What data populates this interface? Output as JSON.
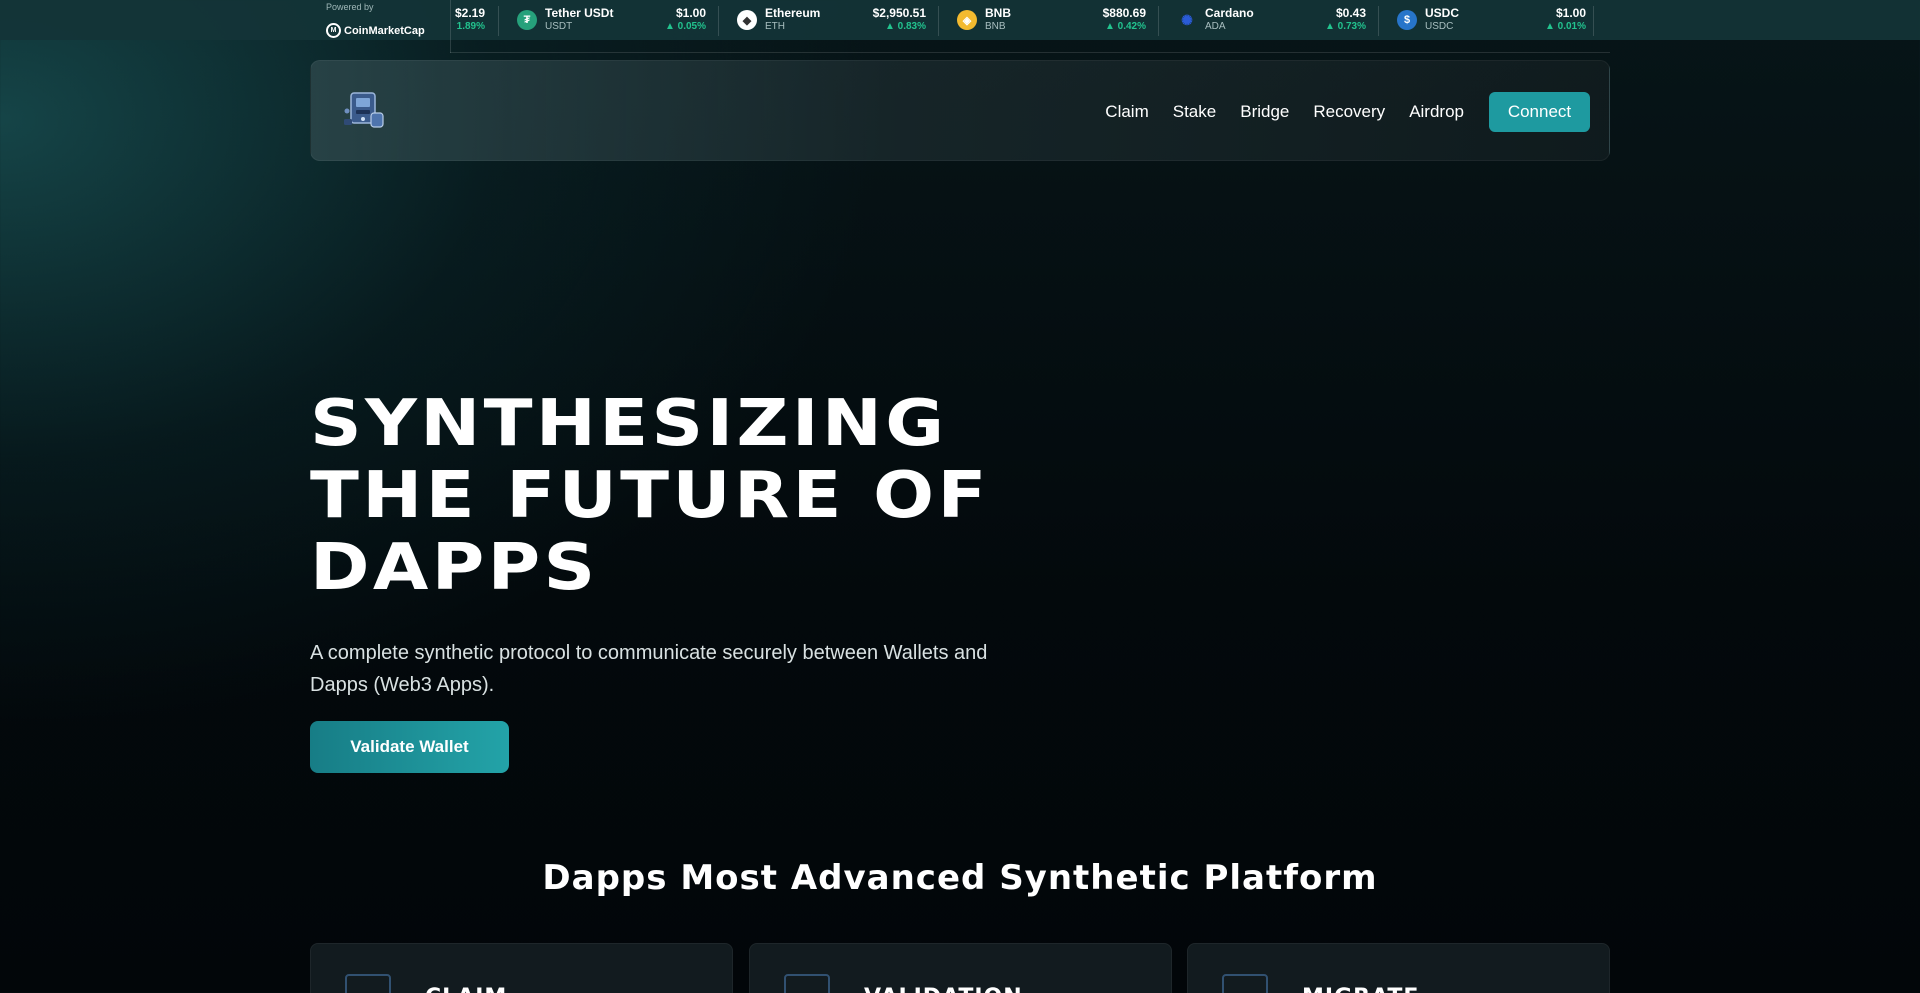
{
  "ticker": {
    "powered_by": "Powered by",
    "brand": "CoinMarketCap",
    "partial": {
      "price": "$2.19",
      "change": "1.89%"
    },
    "coins": [
      {
        "name": "Tether USDt",
        "symbol": "USDT",
        "price": "$1.00",
        "change": "▲ 0.05%",
        "icon": "tether-icon",
        "color": "#26a17b"
      },
      {
        "name": "Ethereum",
        "symbol": "ETH",
        "price": "$2,950.51",
        "change": "▲ 0.83%",
        "icon": "ethereum-icon",
        "color": "#ffffff"
      },
      {
        "name": "BNB",
        "symbol": "BNB",
        "price": "$880.69",
        "change": "▲ 0.42%",
        "icon": "bnb-icon",
        "color": "#f3ba2f"
      },
      {
        "name": "Cardano",
        "symbol": "ADA",
        "price": "$0.43",
        "change": "▲ 0.73%",
        "icon": "cardano-icon",
        "color": "#0033ad"
      },
      {
        "name": "USDC",
        "symbol": "USDC",
        "price": "$1.00",
        "change": "▲ 0.01%",
        "icon": "usdc-icon",
        "color": "#2775ca"
      }
    ]
  },
  "nav": {
    "links": [
      "Claim",
      "Stake",
      "Bridge",
      "Recovery",
      "Airdrop"
    ],
    "connect": "Connect"
  },
  "hero": {
    "title_lines": [
      "SYNTHESIZING",
      "THE FUTURE OF",
      "DAPPS"
    ],
    "subtitle": "A complete synthetic protocol to communicate securely between Wallets and Dapps (Web3 Apps).",
    "cta": "Validate Wallet"
  },
  "section": {
    "title": "Dapps Most Advanced Synthetic Platform",
    "cards": [
      "CLAIM",
      "VALIDATION",
      "MIGRATE"
    ]
  },
  "colors": {
    "accent": "#1e9aa0",
    "positive": "#22c38e"
  }
}
